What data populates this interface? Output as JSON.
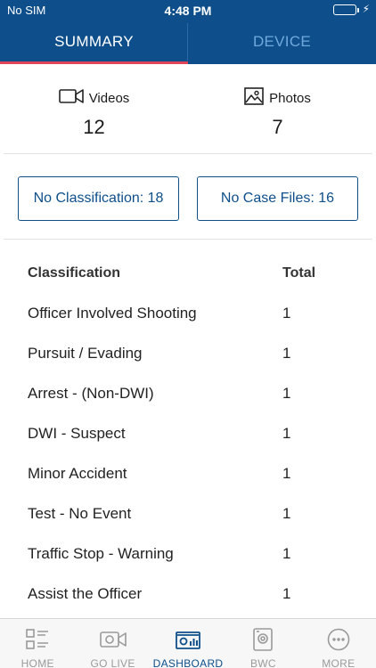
{
  "status_bar": {
    "carrier": "No SIM",
    "time": "4:48 PM"
  },
  "tabs": [
    {
      "label": "SUMMARY",
      "active": true
    },
    {
      "label": "DEVICE",
      "active": false
    }
  ],
  "counts": {
    "videos": {
      "label": "Videos",
      "value": "12"
    },
    "photos": {
      "label": "Photos",
      "value": "7"
    }
  },
  "filters": {
    "no_classification": "No Classification:  18",
    "no_case_files": "No Case Files: 16"
  },
  "table": {
    "headers": {
      "classification": "Classification",
      "total": "Total"
    },
    "rows": [
      {
        "classification": "Officer Involved Shooting",
        "total": "1"
      },
      {
        "classification": "Pursuit / Evading",
        "total": "1"
      },
      {
        "classification": "Arrest - (Non-DWI)",
        "total": "1"
      },
      {
        "classification": "DWI - Suspect",
        "total": "1"
      },
      {
        "classification": "Minor Accident",
        "total": "1"
      },
      {
        "classification": "Test - No Event",
        "total": "1"
      },
      {
        "classification": "Traffic Stop - Warning",
        "total": "1"
      },
      {
        "classification": "Assist the Officer",
        "total": "1"
      }
    ]
  },
  "tabbar": [
    {
      "label": "HOME",
      "icon": "home-list-icon",
      "active": false
    },
    {
      "label": "GO LIVE",
      "icon": "camera-icon",
      "active": false
    },
    {
      "label": "DASHBOARD",
      "icon": "dashboard-icon",
      "active": true
    },
    {
      "label": "BWC",
      "icon": "body-camera-icon",
      "active": false
    },
    {
      "label": "MORE",
      "icon": "more-icon",
      "active": false
    }
  ],
  "colors": {
    "primary": "#0e4f8b",
    "tab_indicator": "#e0455a",
    "inactive_tab": "#6fa8dc",
    "battery": "#4cd964"
  }
}
